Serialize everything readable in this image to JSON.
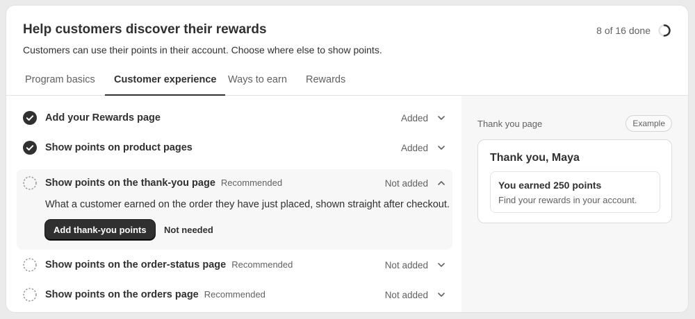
{
  "header": {
    "title": "Help customers discover their rewards",
    "subtitle": "Customers can use their points in their account. Choose where else to show points.",
    "progress_text": "8 of 16 done",
    "progress_fraction": 0.5
  },
  "tabs": [
    {
      "label": "Program basics",
      "active": false
    },
    {
      "label": "Customer experience",
      "active": true
    },
    {
      "label": "Ways to earn",
      "active": false
    },
    {
      "label": "Rewards",
      "active": false
    }
  ],
  "checklist": [
    {
      "title": "Add your Rewards page",
      "tag": "",
      "status": "Added",
      "done": true,
      "expanded": false,
      "icon": "check-circle-icon"
    },
    {
      "title": "Show points on product pages",
      "tag": "",
      "status": "Added",
      "done": true,
      "expanded": false,
      "icon": "check-circle-icon"
    },
    {
      "title": "Show points on the thank-you page",
      "tag": "Recommended",
      "status": "Not added",
      "done": false,
      "expanded": true,
      "icon": "dashed-circle-icon",
      "description": "What a customer earned on the order they have just placed, shown straight after checkout.",
      "primary_action": "Add thank-you points",
      "secondary_action": "Not needed"
    },
    {
      "title": "Show points on the order-status page",
      "tag": "Recommended",
      "status": "Not added",
      "done": false,
      "expanded": false,
      "icon": "dashed-circle-icon"
    },
    {
      "title": "Show points on the orders page",
      "tag": "Recommended",
      "status": "Not added",
      "done": false,
      "expanded": false,
      "icon": "dashed-circle-icon"
    }
  ],
  "preview": {
    "label": "Thank you page",
    "badge": "Example",
    "heading": "Thank you, Maya",
    "inner_title": "You earned 250 points",
    "inner_text": "Find your rewards in your account."
  },
  "colors": {
    "text": "#303030",
    "subdued": "#616161",
    "primary_button": "#303030",
    "panel_bg": "#f7f7f7"
  }
}
